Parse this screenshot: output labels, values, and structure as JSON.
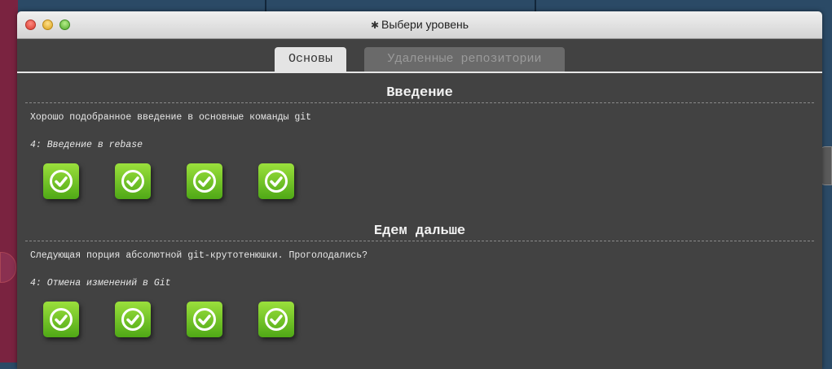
{
  "window": {
    "title": "Выбери уровень",
    "title_icon": "gear-icon"
  },
  "tabs": [
    {
      "label": "Основы",
      "active": true
    },
    {
      "label": "Удаленные репозитории",
      "active": false
    }
  ],
  "sections": [
    {
      "title": "Введение",
      "description": "Хорошо подобранное введение в основные команды git",
      "level_name": "4: Введение в rebase",
      "levels_completed": 4
    },
    {
      "title": "Едем дальше",
      "description": "Следующая порция абсолютной git-крутотенюшки. Проголодались?",
      "level_name": "4: Отмена изменений в Git",
      "levels_completed": 4
    }
  ],
  "colors": {
    "level_complete": "#6cc222",
    "panel_bg": "#424242",
    "tab_active_bg": "#e4e4e4"
  }
}
